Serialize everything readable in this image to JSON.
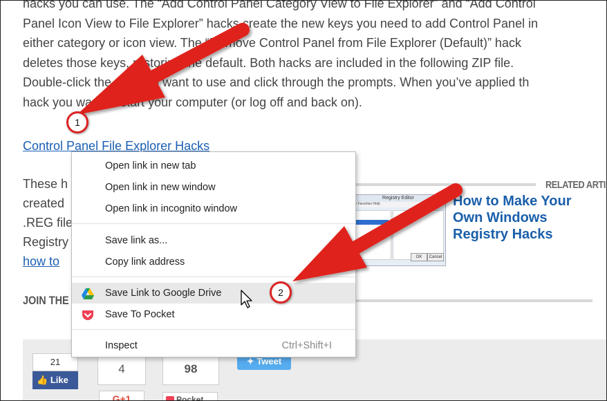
{
  "article": {
    "para1_lines": [
      "hacks you can use. The “Add Control Panel Category View to File Explorer” and “Add Control",
      "Panel Icon View to File Explorer” hacks create the new keys you need to add Control Panel in",
      "either category or icon view. The “Remove Control Panel from File Explorer (Default)” hack",
      "deletes those keys, restoring the default. Both hacks are included in the following ZIP file.",
      "Double-click the one you want to use and click through the prompts. When you’ve applied th",
      "hack you want, restart your computer (or log off and back on)."
    ],
    "download_link": "Control Panel File Explorer Hacks",
    "para2_lines": [
      "These h",
      "created",
      ".REG file",
      "Registry",
      "how to"
    ]
  },
  "related": {
    "label": "RELATED ARTI",
    "title": "How to Make Your Own Windows Registry Hacks",
    "thumb": {
      "window_title": "Registry Editor",
      "menu": "File  Favorites  Help",
      "buttons": [
        "OK",
        "Cancel"
      ]
    }
  },
  "join": {
    "label": "JOIN THE"
  },
  "share": {
    "facebook_count": "21",
    "facebook_like": "Like",
    "google_count": "4",
    "google_label": "G+1",
    "pocket_count": "98",
    "pocket_label": "Pocket",
    "tweet_label": "Tweet"
  },
  "context_menu": {
    "items": [
      {
        "label": "Open link in new tab"
      },
      {
        "label": "Open link in new window"
      },
      {
        "label": "Open link in incognito window"
      },
      {
        "label": "Save link as..."
      },
      {
        "label": "Copy link address"
      },
      {
        "label": "Save Link to Google Drive",
        "icon": "google-drive-icon"
      },
      {
        "label": "Save To Pocket",
        "icon": "pocket-icon"
      },
      {
        "label": "Inspect",
        "shortcut": "Ctrl+Shift+I"
      }
    ]
  },
  "annotations": {
    "badge1": "1",
    "badge2": "2",
    "arrow_color": "#e0201b"
  }
}
